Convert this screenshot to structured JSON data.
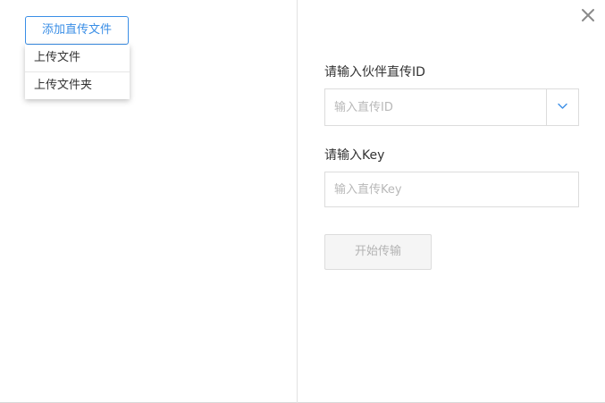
{
  "toolbar": {
    "add_button_label": "添加直传文件"
  },
  "upload_menu": {
    "items": [
      {
        "label": "上传文件"
      },
      {
        "label": "上传文件夹"
      }
    ]
  },
  "form": {
    "partner_id": {
      "label": "请输入伙伴直传ID",
      "placeholder": "输入直传ID",
      "value": ""
    },
    "key": {
      "label": "请输入Key",
      "placeholder": "输入直传Key",
      "value": ""
    },
    "start_button_label": "开始传输"
  },
  "icons": {
    "close": "close-icon",
    "dropdown_toggle": "chevron-down-icon"
  },
  "colors": {
    "accent": "#3a8ee6",
    "placeholder": "#b8b8b8",
    "disabled_text": "#b3b3b3",
    "border": "#dcdcdc"
  }
}
